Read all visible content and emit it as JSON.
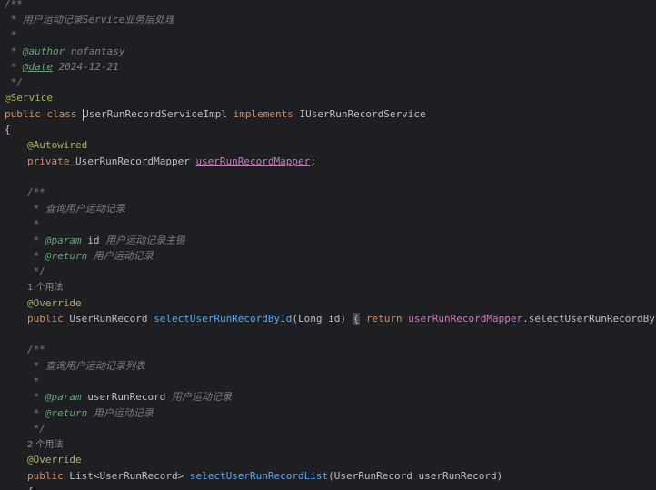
{
  "colors": {
    "background": "#1e1f22",
    "text": "#bcbec4",
    "keyword": "#cf8e6d",
    "annotation": "#b3ae60",
    "comment": "#7a7e85",
    "doc_tag": "#67a37c",
    "field": "#c77dbb",
    "method": "#56a8f5",
    "hint": "#868a91"
  },
  "lines": {
    "doc_open": "/**",
    "doc_desc": " * 用户运动记录Service业务层处理",
    "doc_blank1": " *",
    "doc_author_prefix": " * ",
    "doc_author_tag": "@author",
    "doc_author_value": " nofantasy",
    "doc_date_prefix": " * ",
    "doc_date_tag": "@date",
    "doc_date_value": " 2024-12-21",
    "doc_close": " */",
    "service_annotation": "@Service",
    "class_kw_public": "public",
    "class_kw_class": " class ",
    "class_name": "UserRunRecordServiceImpl",
    "class_kw_implements": " implements ",
    "class_interface": "IUserRunRecordService",
    "open_brace": "{",
    "autowired": "@Autowired",
    "field_kw_private": "private",
    "field_type": " UserRunRecordMapper ",
    "field_name": "userRunRecordMapper",
    "field_semicolon": ";",
    "m1_doc_open": "/**",
    "m1_doc_desc": " * 查询用户运动记录",
    "m1_doc_blank": " *",
    "m1_param_prefix": " * ",
    "m1_param_tag": "@param",
    "m1_param_name": " id",
    "m1_param_desc": " 用户运动记录主键",
    "m1_return_prefix": " * ",
    "m1_return_tag": "@return",
    "m1_return_desc": " 用户运动记录",
    "m1_doc_close": " */",
    "m1_usages": "1 个用法",
    "m1_override": "@Override",
    "m1_public": "public",
    "m1_type": " UserRunRecord ",
    "m1_name": "selectUserRunRecordById",
    "m1_params": "(Long id) ",
    "m1_fold_open": "{",
    "m1_space": " ",
    "m1_return_kw": "return",
    "m1_space2": " ",
    "m1_mapper": "userRunRecordMapper",
    "m1_call": ".selectUserRunRecordById(id);",
    "m2_doc_open": "/**",
    "m2_doc_desc": " * 查询用户运动记录列表",
    "m2_doc_blank": " *",
    "m2_param_prefix": " * ",
    "m2_param_tag": "@param",
    "m2_param_name": " userRunRecord",
    "m2_param_desc": " 用户运动记录",
    "m2_return_prefix": " * ",
    "m2_return_tag": "@return",
    "m2_return_desc": " 用户运动记录",
    "m2_doc_close": " */",
    "m2_usages": "2 个用法",
    "m2_override": "@Override",
    "m2_public": "public",
    "m2_type": " List<UserRunRecord> ",
    "m2_name": "selectUserRunRecordList",
    "m2_params": "(UserRunRecord userRunRecord)",
    "m2_open_brace": "{"
  }
}
